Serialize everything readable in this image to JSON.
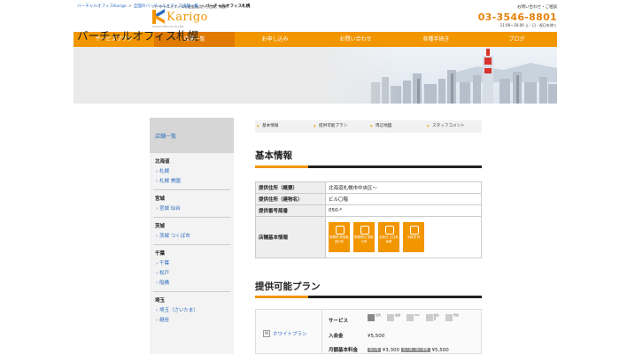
{
  "header": {
    "tagline": "バーチャルオフィスを駐留拠点から比較、検索",
    "logo_text": "Karigo",
    "logo_sub": "Virtual office for the Biz",
    "contact_label": "お問い合わせ・ご相談",
    "phone": "03-3546-8801",
    "hours": "11:00〜16:00 土・日・祝日を除く"
  },
  "nav": {
    "items": [
      "サービスプラン",
      "店舗一覧",
      "お申し込み",
      "お問い合わせ",
      "各種手続き",
      "ブログ"
    ],
    "active_index": 1
  },
  "breadcrumb": {
    "items": [
      "バーチャルオフィスKarigo",
      "全国のバーチャルオフィス店舗一覧",
      "バーチャルオフィス札幌"
    ],
    "separator": ">"
  },
  "page_title": "バーチャルオフィス札幌",
  "sidebar": {
    "heading": "店舗一覧",
    "groups": [
      {
        "pref": "北海道",
        "cities": [
          "札幌",
          "札幌 美園"
        ]
      },
      {
        "pref": "宮城",
        "cities": [
          "宮城 仙台"
        ]
      },
      {
        "pref": "茨城",
        "cities": [
          "茨城 つくば市"
        ]
      },
      {
        "pref": "千葉",
        "cities": [
          "千葉",
          "松戸",
          "船橋"
        ]
      },
      {
        "pref": "埼玉",
        "cities": [
          "埼玉（さいたま）",
          "越谷"
        ]
      }
    ]
  },
  "tabs": [
    "基本情報",
    "提供可能プラン",
    "周辺地図",
    "スタッフコメント"
  ],
  "basic_info": {
    "heading": "基本情報",
    "rows": [
      {
        "key": "提供住所（概要）",
        "value": "北海道札幌市中央区〜"
      },
      {
        "key": "提供住所（建物名）",
        "value": "ビル〇階"
      },
      {
        "key": "提供番号局番",
        "value": "050-*"
      },
      {
        "key": "店舗基本情報",
        "value": ""
      }
    ],
    "services": [
      "郵便物 着信転送の有",
      "郵便物の 受取 の有",
      "定休日 土日祝休業",
      "手続書 有"
    ]
  },
  "plans": {
    "heading": "提供可能プラン",
    "plan_name": "ホワイトプラン",
    "plan_icon": "W",
    "service_label": "サービス",
    "service_icons": [
      "住所",
      "電話",
      "FAX",
      "会議室",
      "登記"
    ],
    "entry_label": "入会金",
    "entry_value": "¥5,500",
    "monthly_label": "月額基本料金",
    "monthly_tag1": "個人様",
    "monthly_value1": "¥3,300",
    "monthly_tag2": "法人様・個人事業",
    "monthly_value2": "¥5,500"
  },
  "colors": {
    "accent": "#f29600",
    "link": "#2a6bbd"
  }
}
